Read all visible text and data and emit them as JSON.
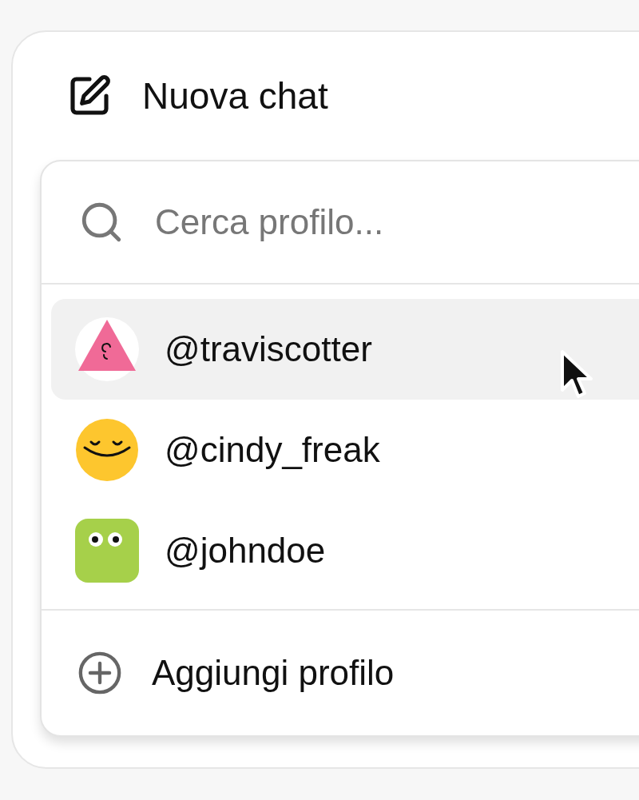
{
  "header": {
    "title": "Nuova chat"
  },
  "search": {
    "placeholder": "Cerca profilo..."
  },
  "profiles": [
    {
      "handle": "@traviscotter",
      "kind": "triangle",
      "selected": true
    },
    {
      "handle": "@cindy_freak",
      "kind": "smile",
      "selected": false
    },
    {
      "handle": "@johndoe",
      "kind": "eyes",
      "selected": false
    }
  ],
  "add_profile": {
    "label": "Aggiungi profilo"
  }
}
